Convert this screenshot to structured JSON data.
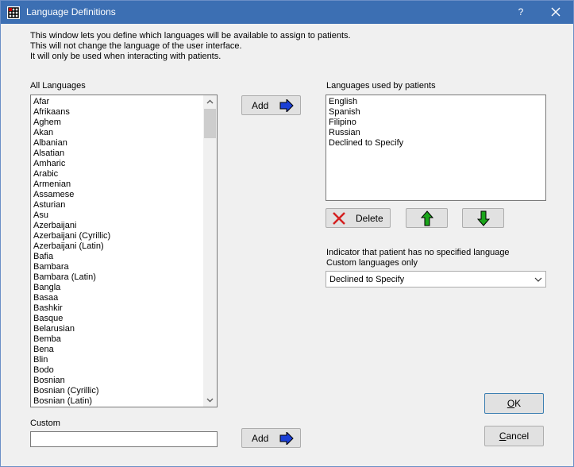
{
  "window": {
    "title": "Language Definitions",
    "help_label": "?"
  },
  "description": {
    "line1": "This window lets you define which languages will be available to assign to patients.",
    "line2": "This will not change the language of the user interface.",
    "line3": "It will only be used when interacting with patients."
  },
  "all_languages": {
    "label": "All Languages",
    "items": [
      "Afar",
      "Afrikaans",
      "Aghem",
      "Akan",
      "Albanian",
      "Alsatian",
      "Amharic",
      "Arabic",
      "Armenian",
      "Assamese",
      "Asturian",
      "Asu",
      "Azerbaijani",
      "Azerbaijani (Cyrillic)",
      "Azerbaijani (Latin)",
      "Bafia",
      "Bambara",
      "Bambara (Latin)",
      "Bangla",
      "Basaa",
      "Bashkir",
      "Basque",
      "Belarusian",
      "Bemba",
      "Bena",
      "Blin",
      "Bodo",
      "Bosnian",
      "Bosnian (Cyrillic)",
      "Bosnian (Latin)"
    ]
  },
  "add_button_top": {
    "label": "Add"
  },
  "patient_languages": {
    "label": "Languages used by patients",
    "items": [
      "English",
      "Spanish",
      "Filipino",
      "Russian",
      "Declined to Specify"
    ]
  },
  "delete_button": {
    "label": "Delete"
  },
  "indicator": {
    "label_line1": "Indicator that patient has no specified language",
    "label_line2": "Custom languages only",
    "selected": "Declined to Specify"
  },
  "custom": {
    "label": "Custom",
    "value": ""
  },
  "add_button_bottom": {
    "label": "Add"
  },
  "ok_button": {
    "label_underlined": "O",
    "label_rest": "K"
  },
  "cancel_button": {
    "label_underlined": "C",
    "label_rest": "ancel"
  },
  "colors": {
    "titlebar": "#3c6fb3",
    "arrow_blue": "#1a3fd6",
    "arrow_green": "#1aa51a",
    "delete_red": "#d42020"
  },
  "icons": {
    "app": "grid-icon",
    "close": "close-icon",
    "add": "right-arrow-icon",
    "delete": "red-x-icon",
    "up": "up-arrow-icon",
    "down": "down-arrow-icon"
  }
}
